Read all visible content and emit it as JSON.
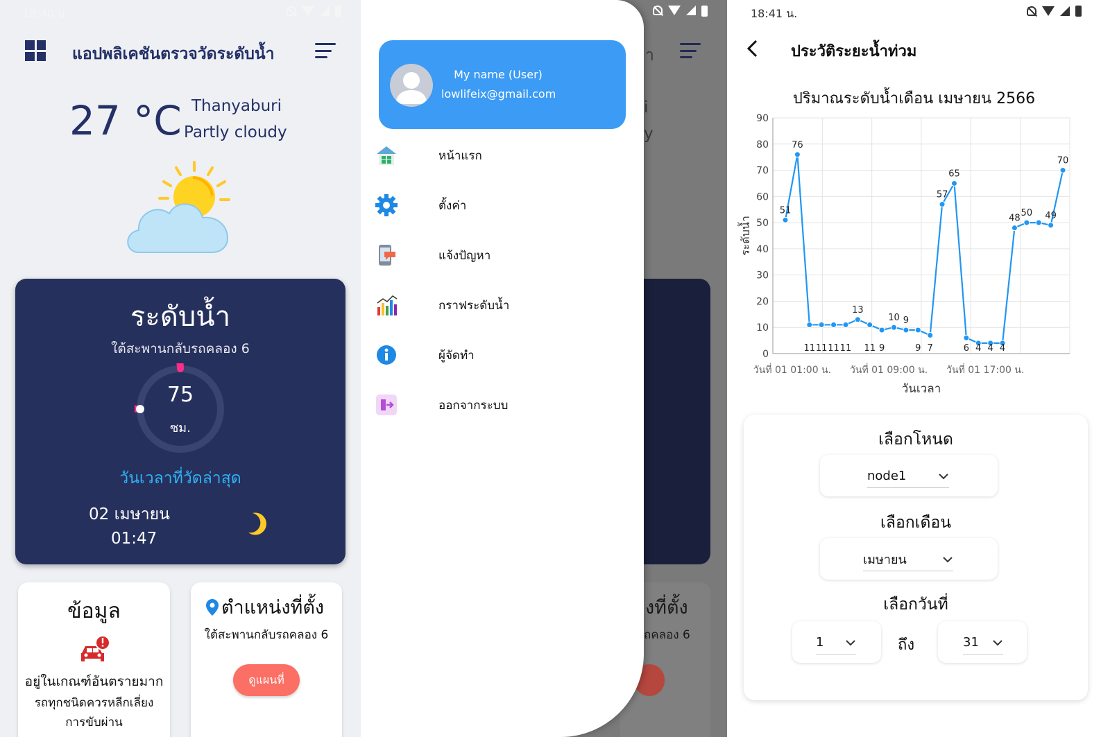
{
  "home": {
    "status_time": "18:40 น.",
    "app_title": "แอปพลิเคชันตรวจวัดระดับน้ำ",
    "temperature": "27 °C",
    "city": "Thanyaburi",
    "condition": "Partly cloudy",
    "level_card": {
      "title": "ระดับน้ำ",
      "location": "ใต้สะพานกลับรถคลอง 6",
      "value": "75",
      "unit": "ซม.",
      "gauge_fraction": 0.75,
      "latest_label": "วันเวลาที่วัดล่าสุด",
      "latest_date": "02 เมษายน",
      "latest_time": "01:47"
    },
    "info_card": {
      "title": "ข้อมูล",
      "status": "อยู่ในเกณฑ์อันตรายมาก",
      "advice_line1": "รถทุกชนิดควรหลีกเลี่ยง",
      "advice_line2": "การขับผ่าน"
    },
    "location_card": {
      "title": "ตำแหน่งที่ตั้ง",
      "place": "ใต้สะพานกลับรถคลอง 6",
      "map_button": "ดูแผนที่"
    }
  },
  "drawer": {
    "user_name": "My name (User)",
    "user_email": "lowlifeix@gmail.com",
    "items": [
      {
        "label": "หน้าแรก",
        "icon": "home-icon"
      },
      {
        "label": "ตั้งค่า",
        "icon": "gear-icon"
      },
      {
        "label": "แจ้งปัญหา",
        "icon": "report-icon"
      },
      {
        "label": "กราฟระดับน้ำ",
        "icon": "chart-icon"
      },
      {
        "label": "ผู้จัดทำ",
        "icon": "info-icon"
      },
      {
        "label": "ออกจากระบบ",
        "icon": "logout-icon"
      }
    ],
    "ghost_title_fragment": "า",
    "ghost_weather_fragment": "i",
    "ghost_condition_fragment": "y",
    "ghost_loc_title": "งที่ตั้ง",
    "ghost_loc_place": "ถคลอง 6",
    "ghost_btn": "ที่"
  },
  "history": {
    "status_time": "18:41 น.",
    "title": "ประวัติระยะน้ำท่วม",
    "select_node_label": "เลือกโหนด",
    "select_node_value": "node1",
    "select_month_label": "เลือกเดือน",
    "select_month_value": "เมษายน",
    "select_day_label": "เลือกวันที่",
    "day_from": "1",
    "to_label": "ถึง",
    "day_to": "31"
  },
  "chart_data": {
    "type": "line",
    "title": "ปริมาณระดับน้ำเดือน เมษายน 2566",
    "xlabel": "วันเวลา",
    "ylabel": "ระดับน้ำ",
    "ylim": [
      0,
      90
    ],
    "yticks": [
      0,
      10,
      20,
      30,
      40,
      50,
      60,
      70,
      80,
      90
    ],
    "xtick_labels": [
      "วันที่ 01 01:00 น.",
      "วันที่ 01 09:00 น.",
      "วันที่ 01 17:00 น."
    ],
    "xtick_indices": [
      0,
      8,
      16
    ],
    "grid": true,
    "color": "#2196f3",
    "values": [
      51,
      76,
      11,
      11,
      11,
      11,
      13,
      11,
      9,
      10,
      9,
      9,
      7,
      57,
      65,
      6,
      4,
      4,
      4,
      48,
      50,
      50,
      49,
      70
    ],
    "point_labels": [
      "51",
      "76",
      "11",
      "11",
      "11",
      "11",
      "13",
      "11",
      "9",
      "10",
      "9",
      "9",
      "7",
      "57",
      "65",
      "6",
      "4",
      "4",
      "4",
      "48",
      "50",
      "",
      "49",
      "70"
    ]
  }
}
